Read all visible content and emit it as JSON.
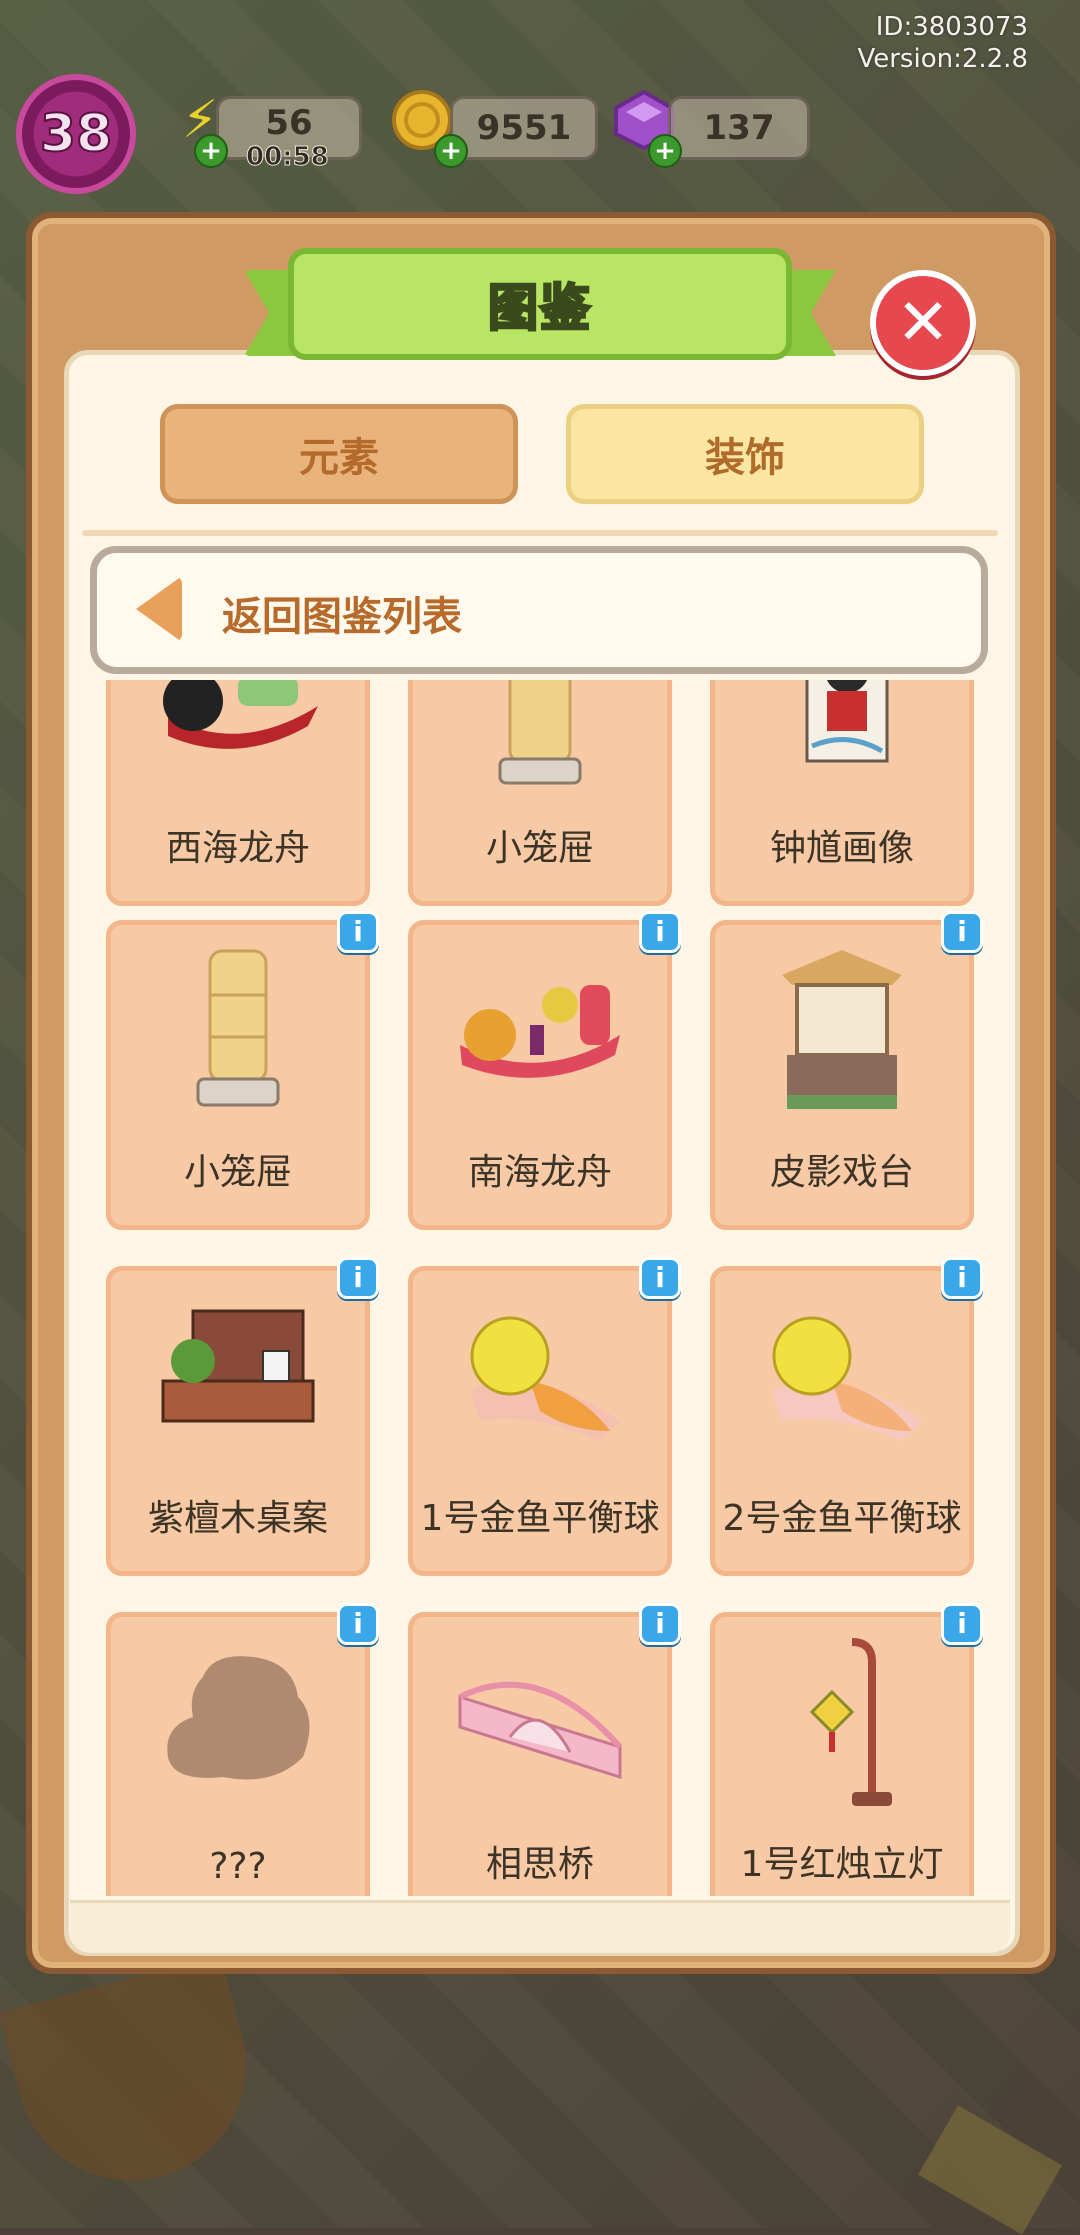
{
  "hud": {
    "level": "38",
    "energy": "56",
    "energy_timer": "00:58",
    "coins": "9551",
    "gems": "137",
    "user_id": "ID:3803073",
    "version": "Version:2.2.8"
  },
  "dialog": {
    "title": "图鉴",
    "tabs": [
      "元素",
      "装饰"
    ],
    "selected_tab": "装饰",
    "back_label": "返回图鉴列表"
  },
  "items": [
    {
      "label": "西海龙舟",
      "icon": "dragon-boat-black-icon",
      "info": false
    },
    {
      "label": "小笼屉",
      "icon": "steamer-icon",
      "info": false
    },
    {
      "label": "钟馗画像",
      "icon": "zhongkui-portrait-icon",
      "info": false
    },
    {
      "label": "小笼屉",
      "icon": "steamer-icon",
      "info": true
    },
    {
      "label": "南海龙舟",
      "icon": "dragon-boat-red-icon",
      "info": true
    },
    {
      "label": "皮影戏台",
      "icon": "shadow-puppet-stage-icon",
      "info": true
    },
    {
      "label": "紫檀木桌案",
      "icon": "rosewood-table-icon",
      "info": true
    },
    {
      "label": "1号金鱼平衡球",
      "icon": "goldfish-ball-icon",
      "info": true
    },
    {
      "label": "2号金鱼平衡球",
      "icon": "goldfish-ball-icon",
      "info": true
    },
    {
      "label": "???",
      "icon": "unknown-silhouette-icon",
      "info": true
    },
    {
      "label": "相思桥",
      "icon": "pink-bridge-icon",
      "info": true
    },
    {
      "label": "1号红烛立灯",
      "icon": "red-candle-lamp-icon",
      "info": true
    }
  ],
  "colors": {
    "panel": "#cf9a63",
    "paper": "#fdf6e6",
    "card": "#f7c9a4",
    "banner": "#b8e564",
    "close": "#e6484e",
    "info": "#3aa8e8"
  }
}
